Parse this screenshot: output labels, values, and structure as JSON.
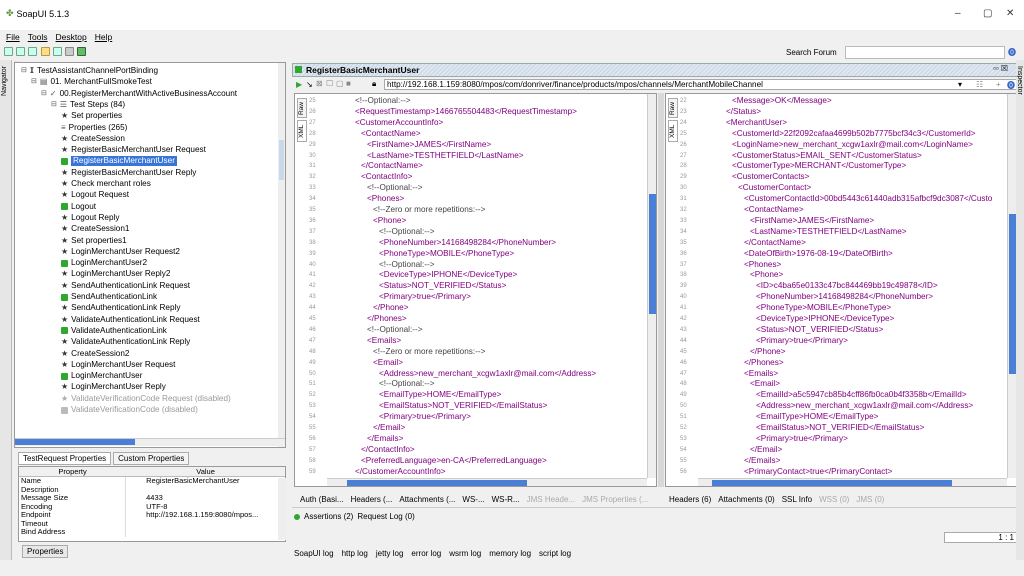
{
  "window": {
    "title": "SoapUI 5.1.3",
    "min": "–",
    "max": "▢",
    "close": "✕"
  },
  "menu": [
    "File",
    "Tools",
    "Desktop",
    "Help"
  ],
  "toolbar": {
    "search_label": "Search Forum"
  },
  "navigator": {
    "label": "Navigator"
  },
  "inspector": {
    "label": "Inspector"
  },
  "tree": [
    {
      "label": "TestAssistantChannelPortBinding",
      "icon": "interface-icon",
      "indent": 0
    },
    {
      "label": "01. MerchantFullSmokeTest",
      "icon": "testsuite-icon",
      "indent": 1
    },
    {
      "label": "00.RegisterMerchantWithActiveBusinessAccount",
      "icon": "testcase-icon",
      "indent": 2
    },
    {
      "label": "Test Steps (84)",
      "icon": "steps-icon",
      "indent": 3
    },
    {
      "label": "Set properties",
      "icon": "star",
      "indent": 4
    },
    {
      "label": "Properties (265)",
      "icon": "properties-icon",
      "indent": 4
    },
    {
      "label": "CreateSession",
      "icon": "star",
      "indent": 4
    },
    {
      "label": "RegisterBasicMerchantUser Request",
      "icon": "star",
      "indent": 4
    },
    {
      "label": "RegisterBasicMerchantUser",
      "icon": "green",
      "indent": 4,
      "selected": true
    },
    {
      "label": "RegisterBasicMerchantUser Reply",
      "icon": "star",
      "indent": 4
    },
    {
      "label": "Check merchant roles",
      "icon": "star",
      "indent": 4
    },
    {
      "label": "Logout Request",
      "icon": "star",
      "indent": 4
    },
    {
      "label": "Logout",
      "icon": "green",
      "indent": 4
    },
    {
      "label": "Logout Reply",
      "icon": "star",
      "indent": 4
    },
    {
      "label": "CreateSession1",
      "icon": "star",
      "indent": 4
    },
    {
      "label": "Set properties1",
      "icon": "star",
      "indent": 4
    },
    {
      "label": "LoginMerchantUser Request2",
      "icon": "star",
      "indent": 4
    },
    {
      "label": "LoginMerchantUser2",
      "icon": "green",
      "indent": 4
    },
    {
      "label": "LoginMerchantUser Reply2",
      "icon": "star",
      "indent": 4
    },
    {
      "label": "SendAuthenticationLink Request",
      "icon": "star",
      "indent": 4
    },
    {
      "label": "SendAuthenticationLink",
      "icon": "green",
      "indent": 4
    },
    {
      "label": "SendAuthenticationLink Reply",
      "icon": "star",
      "indent": 4
    },
    {
      "label": "ValidateAuthenticationLink Request",
      "icon": "star",
      "indent": 4
    },
    {
      "label": "ValidateAuthenticationLink",
      "icon": "green",
      "indent": 4
    },
    {
      "label": "ValidateAuthenticationLink Reply",
      "icon": "star",
      "indent": 4
    },
    {
      "label": "CreateSession2",
      "icon": "star",
      "indent": 4
    },
    {
      "label": "LoginMerchantUser Request",
      "icon": "star",
      "indent": 4
    },
    {
      "label": "LoginMerchantUser",
      "icon": "green",
      "indent": 4
    },
    {
      "label": "LoginMerchantUser Reply",
      "icon": "star",
      "indent": 4
    },
    {
      "label": "ValidateVerificationCode Request (disabled)",
      "icon": "star",
      "indent": 4,
      "disabled": true
    },
    {
      "label": "ValidateVerificationCode (disabled)",
      "icon": "green",
      "indent": 4,
      "disabled": true
    }
  ],
  "props_tabs": [
    "TestRequest Properties",
    "Custom Properties"
  ],
  "props_header": {
    "col1": "Property",
    "col2": "Value"
  },
  "props": [
    {
      "k": "Name",
      "v": "RegisterBasicMerchantUser"
    },
    {
      "k": "Description",
      "v": ""
    },
    {
      "k": "Message Size",
      "v": "4433"
    },
    {
      "k": "Encoding",
      "v": "UTF-8"
    },
    {
      "k": "Endpoint",
      "v": "http://192.168.1.159:8080/mpos..."
    },
    {
      "k": "Timeout",
      "v": ""
    },
    {
      "k": "Bind Address",
      "v": ""
    }
  ],
  "props_button": "Properties",
  "editor": {
    "title": "RegisterBasicMerchantUser",
    "url": "http://192.168.1.159:8080/mpos/com/donriver/finance/products/mpos/channels/MerchantMobileChannel",
    "left_tabs": [
      "Raw",
      "XML"
    ],
    "right_tabs": [
      "Raw",
      "XML"
    ]
  },
  "request_lines": [
    {
      "n": "25",
      "ind": 0,
      "t": "<!--Optional:-->",
      "k": "c"
    },
    {
      "n": "26",
      "ind": 0,
      "t": "<RequestTimestamp>1466765504483</RequestTimestamp>"
    },
    {
      "n": "27",
      "ind": 0,
      "t": "<CustomerAccountInfo>"
    },
    {
      "n": "28",
      "ind": 1,
      "t": "<ContactName>"
    },
    {
      "n": "29",
      "ind": 2,
      "t": "<FirstName>JAMES</FirstName>"
    },
    {
      "n": "30",
      "ind": 2,
      "t": "<LastName>TESTHETFIELD</LastName>"
    },
    {
      "n": "31",
      "ind": 1,
      "t": "</ContactName>"
    },
    {
      "n": "32",
      "ind": 1,
      "t": "<ContactInfo>"
    },
    {
      "n": "33",
      "ind": 2,
      "t": "<!--Optional:-->",
      "k": "c"
    },
    {
      "n": "34",
      "ind": 2,
      "t": "<Phones>"
    },
    {
      "n": "35",
      "ind": 3,
      "t": "<!--Zero or more repetitions:-->",
      "k": "c"
    },
    {
      "n": "36",
      "ind": 3,
      "t": "<Phone>"
    },
    {
      "n": "37",
      "ind": 4,
      "t": "<!--Optional:-->",
      "k": "c"
    },
    {
      "n": "38",
      "ind": 4,
      "t": "<PhoneNumber>14168498284</PhoneNumber>"
    },
    {
      "n": "39",
      "ind": 4,
      "t": "<PhoneType>MOBILE</PhoneType>"
    },
    {
      "n": "40",
      "ind": 4,
      "t": "<!--Optional:-->",
      "k": "c"
    },
    {
      "n": "41",
      "ind": 4,
      "t": "<DeviceType>IPHONE</DeviceType>"
    },
    {
      "n": "42",
      "ind": 4,
      "t": "<Status>NOT_VERIFIED</Status>"
    },
    {
      "n": "43",
      "ind": 4,
      "t": "<Primary>true</Primary>"
    },
    {
      "n": "44",
      "ind": 3,
      "t": "</Phone>"
    },
    {
      "n": "45",
      "ind": 2,
      "t": "</Phones>"
    },
    {
      "n": "46",
      "ind": 2,
      "t": "<!--Optional:-->",
      "k": "c"
    },
    {
      "n": "47",
      "ind": 2,
      "t": "<Emails>"
    },
    {
      "n": "48",
      "ind": 3,
      "t": "<!--Zero or more repetitions:-->",
      "k": "c"
    },
    {
      "n": "49",
      "ind": 3,
      "t": "<Email>"
    },
    {
      "n": "50",
      "ind": 4,
      "t": "<Address>new_merchant_xcgw1axlr@mail.com</Address>"
    },
    {
      "n": "51",
      "ind": 4,
      "t": "<!--Optional:-->",
      "k": "c"
    },
    {
      "n": "52",
      "ind": 4,
      "t": "<EmailType>HOME</EmailType>"
    },
    {
      "n": "53",
      "ind": 4,
      "t": "<EmailStatus>NOT_VERIFIED</EmailStatus>"
    },
    {
      "n": "54",
      "ind": 4,
      "t": "<Primary>true</Primary>"
    },
    {
      "n": "55",
      "ind": 3,
      "t": "</Email>"
    },
    {
      "n": "56",
      "ind": 2,
      "t": "</Emails>"
    },
    {
      "n": "57",
      "ind": 1,
      "t": "</ContactInfo>"
    },
    {
      "n": "58",
      "ind": 1,
      "t": "<PreferredLanguage>en-CA</PreferredLanguage>"
    },
    {
      "n": "59",
      "ind": 0,
      "t": "</CustomerAccountInfo>"
    }
  ],
  "response_lines": [
    {
      "n": "22",
      "ind": 1,
      "t": "<Message>OK</Message>"
    },
    {
      "n": "23",
      "ind": 0,
      "t": "</Status>"
    },
    {
      "n": "24",
      "ind": 0,
      "t": "<MerchantUser>"
    },
    {
      "n": "25",
      "ind": 1,
      "t": "<CustomerId>22f2092cafaa4699b502b7775bcf34c3</CustomerId>"
    },
    {
      "n": "26",
      "ind": 1,
      "t": "<LoginName>new_merchant_xcgw1axlr@mail.com</LoginName>"
    },
    {
      "n": "27",
      "ind": 1,
      "t": "<CustomerStatus>EMAIL_SENT</CustomerStatus>"
    },
    {
      "n": "28",
      "ind": 1,
      "t": "<CustomerType>MERCHANT</CustomerType>"
    },
    {
      "n": "29",
      "ind": 1,
      "t": "<CustomerContacts>"
    },
    {
      "n": "30",
      "ind": 2,
      "t": "<CustomerContact>"
    },
    {
      "n": "31",
      "ind": 3,
      "t": "<CustomerContactId>00bd5443c61440adb315afbcf9dc3087</Custo"
    },
    {
      "n": "32",
      "ind": 3,
      "t": "<ContactName>"
    },
    {
      "n": "33",
      "ind": 4,
      "t": "<FirstName>JAMES</FirstName>"
    },
    {
      "n": "34",
      "ind": 4,
      "t": "<LastName>TESTHETFIELD</LastName>"
    },
    {
      "n": "35",
      "ind": 3,
      "t": "</ContactName>"
    },
    {
      "n": "36",
      "ind": 3,
      "t": "<DateOfBirth>1976-08-19</DateOfBirth>"
    },
    {
      "n": "37",
      "ind": 3,
      "t": "<Phones>"
    },
    {
      "n": "38",
      "ind": 4,
      "t": "<Phone>"
    },
    {
      "n": "39",
      "ind": 5,
      "t": "<ID>c4ba65e0133c47bc844469bb19c49878</ID>"
    },
    {
      "n": "40",
      "ind": 5,
      "t": "<PhoneNumber>14168498284</PhoneNumber>"
    },
    {
      "n": "41",
      "ind": 5,
      "t": "<PhoneType>MOBILE</PhoneType>"
    },
    {
      "n": "42",
      "ind": 5,
      "t": "<DeviceType>IPHONE</DeviceType>"
    },
    {
      "n": "43",
      "ind": 5,
      "t": "<Status>NOT_VERIFIED</Status>"
    },
    {
      "n": "44",
      "ind": 5,
      "t": "<Primary>true</Primary>"
    },
    {
      "n": "45",
      "ind": 4,
      "t": "</Phone>"
    },
    {
      "n": "46",
      "ind": 3,
      "t": "</Phones>"
    },
    {
      "n": "47",
      "ind": 3,
      "t": "<Emails>"
    },
    {
      "n": "48",
      "ind": 4,
      "t": "<Email>"
    },
    {
      "n": "49",
      "ind": 5,
      "t": "<EmailId>a5c5947cb85b4cff86fb0ca0b4f3358b</EmailId>"
    },
    {
      "n": "50",
      "ind": 5,
      "t": "<Address>new_merchant_xcgw1axlr@mail.com</Address>"
    },
    {
      "n": "51",
      "ind": 5,
      "t": "<EmailType>HOME</EmailType>"
    },
    {
      "n": "52",
      "ind": 5,
      "t": "<EmailStatus>NOT_VERIFIED</EmailStatus>"
    },
    {
      "n": "53",
      "ind": 5,
      "t": "<Primary>true</Primary>"
    },
    {
      "n": "54",
      "ind": 4,
      "t": "</Email>"
    },
    {
      "n": "55",
      "ind": 3,
      "t": "</Emails>"
    },
    {
      "n": "56",
      "ind": 3,
      "t": "<PrimaryContact>true</PrimaryContact>"
    }
  ],
  "request_tabs": [
    {
      "label": "Auth (Basi...",
      "disabled": false
    },
    {
      "label": "Headers (...",
      "disabled": false
    },
    {
      "label": "Attachments (...",
      "disabled": false
    },
    {
      "label": "WS-...",
      "disabled": false
    },
    {
      "label": "WS-R...",
      "disabled": false
    },
    {
      "label": "JMS Heade...",
      "disabled": true
    },
    {
      "label": "JMS Properties (...",
      "disabled": true
    }
  ],
  "response_tabs": [
    {
      "label": "Headers (6)",
      "disabled": false
    },
    {
      "label": "Attachments (0)",
      "disabled": false
    },
    {
      "label": "SSL Info",
      "disabled": false
    },
    {
      "label": "WSS (0)",
      "disabled": true
    },
    {
      "label": "JMS (0)",
      "disabled": true
    }
  ],
  "assertions": {
    "assertions": "Assertions (2)",
    "log": "Request Log (0)"
  },
  "cursor_pos": "1 : 1",
  "logs": [
    "SoapUI log",
    "http log",
    "jetty log",
    "error log",
    "wsrm log",
    "memory log",
    "script log"
  ],
  "colors": {
    "tag": "#800080",
    "selected": "#3875d7",
    "ok": "#2ea82e"
  }
}
